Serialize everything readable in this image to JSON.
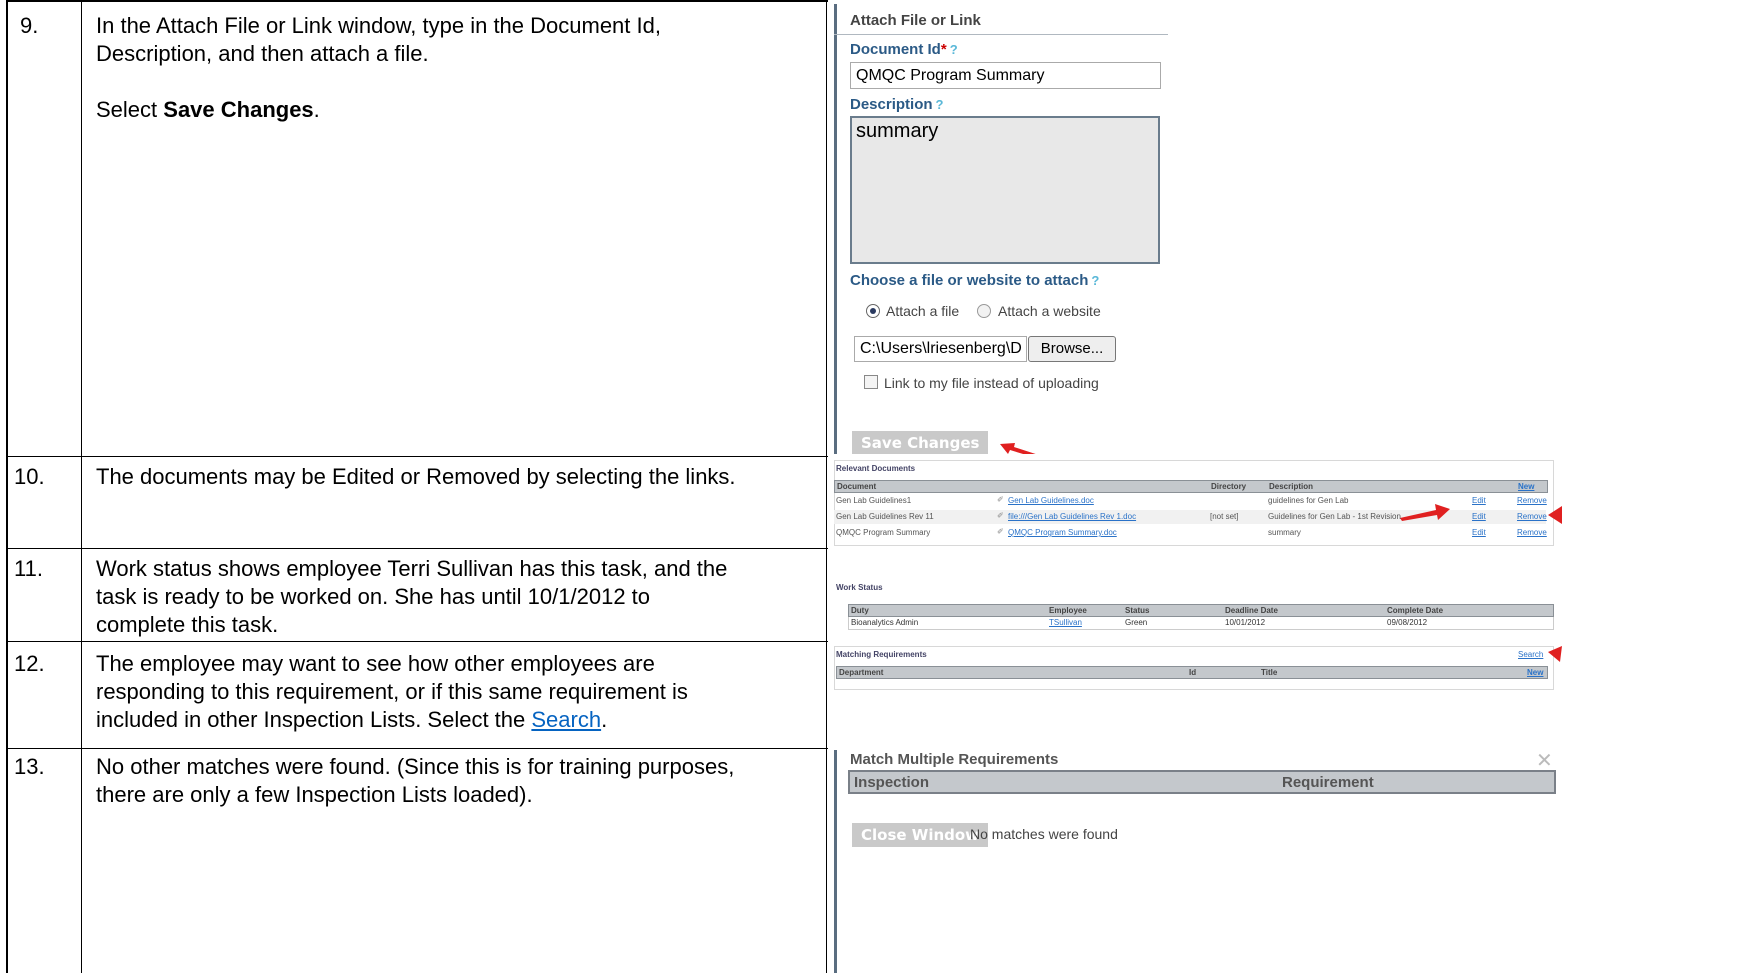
{
  "rows": [
    {
      "step": "9.",
      "text_lines": [
        "In the Attach File or Link window, type in the Document Id,",
        "Description, and then attach a file."
      ],
      "text2_prefix": "Select ",
      "text2_bold": "Save Changes",
      "text2_suffix": "."
    },
    {
      "step": "10.",
      "text": "The documents may be Edited or Removed by selecting the links."
    },
    {
      "step": "11.",
      "text_lines": [
        "Work status shows employee Terri Sullivan has this task, and the",
        "task is ready to be worked on.  She has until 10/1/2012 to",
        "complete this task."
      ]
    },
    {
      "step": "12.",
      "text_lines": [
        "The employee may want to see how other employees are",
        "responding to this requirement, or if this same requirement is"
      ],
      "text_last_prefix": "included in other Inspection Lists.  Select the ",
      "text_last_link": "Search",
      "text_last_suffix": "."
    },
    {
      "step": "13.",
      "text_lines": [
        "No other matches were found.  (Since this is for training purposes,",
        "there are only a few Inspection Lists loaded)."
      ]
    }
  ],
  "attach": {
    "title": "Attach File or Link",
    "doc_id_label": "Document Id",
    "required_mark": "*",
    "help": "?",
    "doc_id_value": "QMQC Program Summary",
    "description_label": "Description",
    "description_value": "summary",
    "choose_label": "Choose a file or website to attach",
    "radio_file": "Attach a file",
    "radio_website": "Attach a website",
    "file_path": "C:\\Users\\lriesenberg\\D",
    "browse": "Browse...",
    "link_checkbox": "Link to my file instead of uploading",
    "save": "Save Changes"
  },
  "relevant_docs": {
    "title": "Relevant Documents",
    "headers": [
      "Document",
      "Directory",
      "Description",
      "New"
    ],
    "rows": [
      {
        "document": "Gen Lab Guidelines1",
        "file": "Gen Lab Guidelines.doc",
        "directory": "",
        "description": "guidelines for Gen Lab",
        "edit": "Edit",
        "remove": "Remove"
      },
      {
        "document": "Gen Lab Guidelines Rev 11",
        "file": "file:///Gen Lab Guidelines Rev 1.doc",
        "directory": "[not set]",
        "description": "Guidelines for Gen Lab - 1st Revision",
        "edit": "Edit",
        "remove": "Remove"
      },
      {
        "document": "QMQC Program Summary",
        "file": "QMQC Program Summary.doc",
        "directory": "",
        "description": "summary",
        "edit": "Edit",
        "remove": "Remove"
      }
    ]
  },
  "work_status": {
    "title": "Work Status",
    "headers": [
      "Duty",
      "Employee",
      "Status",
      "Deadline Date",
      "Complete Date"
    ],
    "row": {
      "duty": "Bioanalytics Admin",
      "employee": "TSullivan",
      "status": "Green",
      "deadline": "10/01/2012",
      "complete": "09/08/2012"
    }
  },
  "matching": {
    "title": "Matching Requirements",
    "search": "Search",
    "headers": [
      "Department",
      "Id",
      "Title"
    ],
    "new": "New"
  },
  "match_multiple": {
    "title": "Match Multiple Requirements",
    "headers": [
      "Inspection",
      "Requirement"
    ],
    "close": "Close Window",
    "no_matches": "No matches were found"
  },
  "colors": {
    "arrow": "#e02020",
    "label_blue": "#2b5a86",
    "header_gray": "#c4c8cc"
  }
}
